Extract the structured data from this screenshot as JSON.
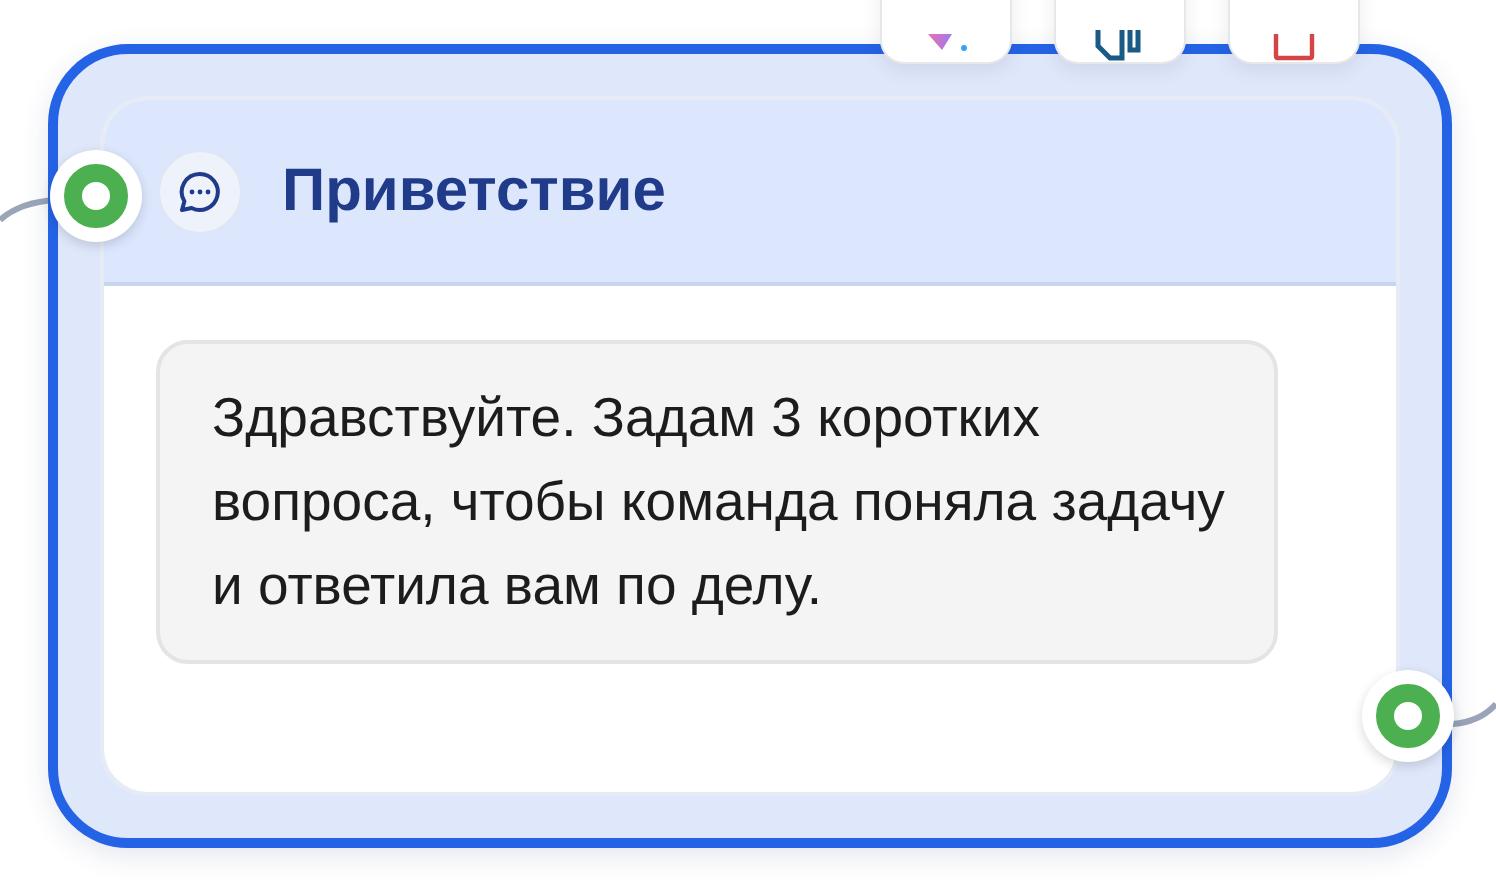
{
  "node": {
    "title": "Приветствие",
    "selected": true,
    "message": "Здравствуйте. Задам 3 коротких вопроса, чтобы команда поняла задачу и ответила вам по делу."
  }
}
